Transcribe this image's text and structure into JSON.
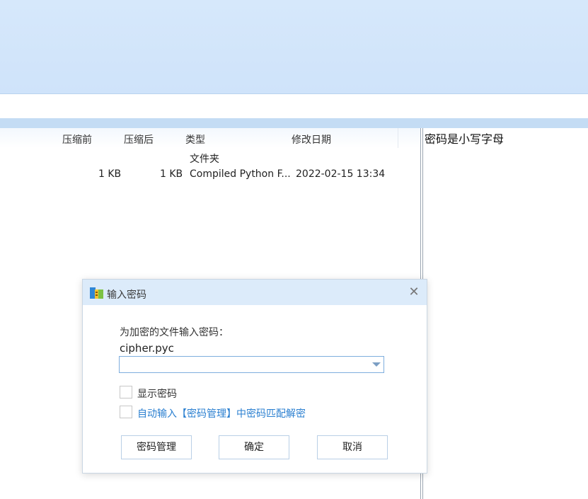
{
  "file_list": {
    "columns": [
      "压缩前",
      "压缩后",
      "类型",
      "修改日期"
    ],
    "rows": [
      {
        "original": "",
        "compressed": "",
        "type": "文件夹",
        "modified": ""
      },
      {
        "original": "1 KB",
        "compressed": "1 KB",
        "type": "Compiled Python F...",
        "modified": "2022-02-15 13:34"
      }
    ]
  },
  "comment": {
    "text": "密码是小写字母"
  },
  "dialog": {
    "title": "输入密码",
    "prompt": "为加密的文件输入密码：",
    "filename": "cipher.pyc",
    "password_value": "",
    "show_password_label": "显示密码",
    "auto_fill_label": "自动输入【密码管理】中密码匹配解密",
    "buttons": {
      "manage": "密码管理",
      "ok": "确定",
      "cancel": "取消"
    },
    "close_glyph": "✕"
  },
  "colors": {
    "toolbar_bg": "#d6e8fb",
    "link": "#2a7fd0",
    "dialog_title_bg": "#dcebfa"
  }
}
